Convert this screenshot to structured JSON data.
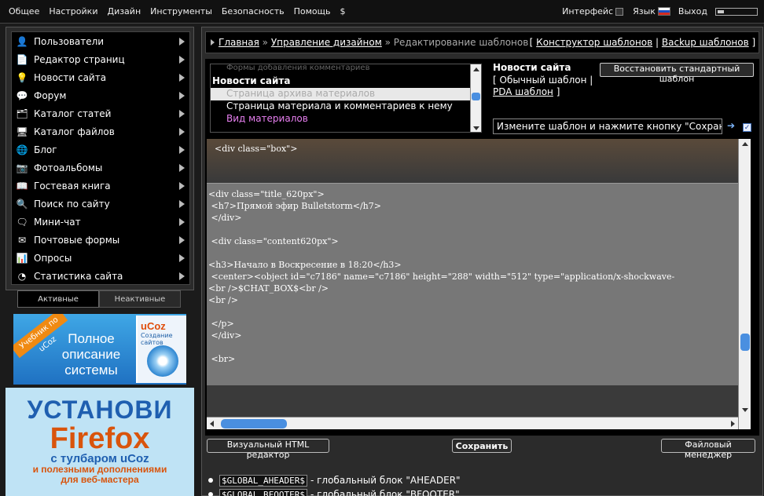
{
  "topmenu": {
    "items": [
      "Общее",
      "Настройки",
      "Дизайн",
      "Инструменты",
      "Безопасность",
      "Помощь",
      "$"
    ],
    "interface_label": "Интерфейс",
    "language_label": "Язык",
    "logout_label": "Выход"
  },
  "sidebar": {
    "items": [
      {
        "label": "Пользователи",
        "icon": "users-icon"
      },
      {
        "label": "Редактор страниц",
        "icon": "page-editor-icon"
      },
      {
        "label": "Новости сайта",
        "icon": "news-icon"
      },
      {
        "label": "Форум",
        "icon": "forum-icon"
      },
      {
        "label": "Каталог статей",
        "icon": "articles-icon"
      },
      {
        "label": "Каталог файлов",
        "icon": "files-icon"
      },
      {
        "label": "Блог",
        "icon": "blog-icon"
      },
      {
        "label": "Фотоальбомы",
        "icon": "camera-icon"
      },
      {
        "label": "Гостевая книга",
        "icon": "guestbook-icon"
      },
      {
        "label": "Поиск по сайту",
        "icon": "search-icon"
      },
      {
        "label": "Мини-чат",
        "icon": "chat-icon"
      },
      {
        "label": "Почтовые формы",
        "icon": "mail-icon"
      },
      {
        "label": "Опросы",
        "icon": "poll-icon"
      },
      {
        "label": "Статистика сайта",
        "icon": "stats-icon"
      }
    ],
    "tab_active": "Активные",
    "tab_inactive": "Неактивные"
  },
  "banner1": {
    "tag": "Учебник по uCoz",
    "text": "Полное описание системы",
    "book_title": "uCoz",
    "book_sub": "Создание сайтов"
  },
  "banner2": {
    "line1": "УСТАНОВИ",
    "line2": "Firefox",
    "line3": "с тулбаром uCoz",
    "line4": "и полезными дополнениями",
    "line5": "для веб-мастера"
  },
  "breadcrumb": {
    "home": "Главная",
    "design": "Управление дизайном",
    "current": "Редактирование шаблонов",
    "constructor": "Конструктор шаблонов",
    "backup": "Backup шаблонов"
  },
  "templates": {
    "list_top": "Формы добавления комментариев",
    "section": "Новости сайта",
    "items": [
      "Страница архива материалов",
      "Страница материала и комментариев к нему",
      "Вид материалов"
    ],
    "info_title": "Новости сайта",
    "opt_normal": "Обычный шаблон",
    "opt_pda": "PDA шаблон",
    "restore_label": "Восстановить стандартный шаблон",
    "hint": "Измените шаблон и нажмите кнопку \"Сохранить\""
  },
  "editor": {
    "head_line": "<div class=\"box\">",
    "code": "<div class=\"title_620px\">\n <h7>Прямой эфир Bulletstorm</h7>\n </div>\n\n <div class=\"content620px\">\n\n<h3>Начало в Воскресение в 18:20</h3>\n <center><object id=\"c7186\" name=\"c7186\" height=\"288\" width=\"512\" type=\"application/x-shockwave-\n<br />$CHAT_BOX$<br />\n<br />\n\n </p>\n </div>\n\n <br>"
  },
  "buttons": {
    "visual": "Визуальный HTML редактор",
    "save": "Сохранить",
    "files": "Файловый менеджер"
  },
  "vars": [
    {
      "code": "$GLOBAL_AHEADER$",
      "desc": "- глобальный блок \"AHEADER\""
    },
    {
      "code": "$GLOBAL_BFOOTER$",
      "desc": "- глобальный блок \"BFOOTER\""
    }
  ]
}
